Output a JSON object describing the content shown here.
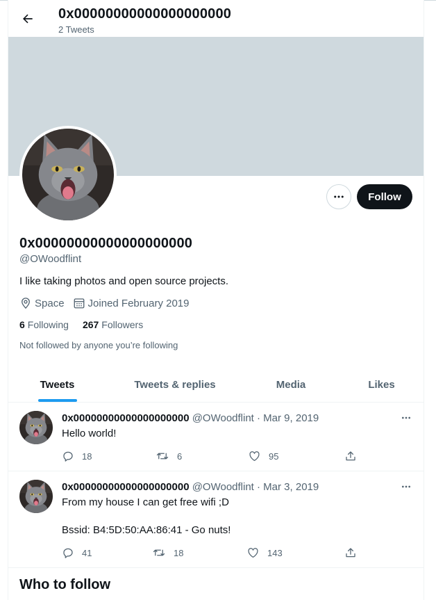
{
  "header": {
    "title": "0x00000000000000000000",
    "tweet_count": "2 Tweets"
  },
  "profile": {
    "display_name": "0x00000000000000000000",
    "handle": "@OWoodflint",
    "bio": "I like taking photos and open source projects.",
    "location": "Space",
    "joined": "Joined February 2019",
    "following_count": "6",
    "following_label": "Following",
    "followers_count": "267",
    "followers_label": "Followers",
    "not_followed": "Not followed by anyone you’re following",
    "follow_label": "Follow"
  },
  "tabs": [
    "Tweets",
    "Tweets & replies",
    "Media",
    "Likes"
  ],
  "tweets": [
    {
      "name": "0x00000000000000000000",
      "meta": "@OWoodflint · Mar 9, 2019",
      "lines": [
        "Hello world!"
      ],
      "replies": "18",
      "retweets": "6",
      "likes": "95"
    },
    {
      "name": "0x00000000000000000000",
      "meta": "@OWoodflint · Mar 3, 2019",
      "lines": [
        "From my house I can get free wifi ;D",
        "",
        "Bssid: B4:5D:50:AA:86:41 - Go nuts!"
      ],
      "replies": "41",
      "retweets": "18",
      "likes": "143"
    }
  ],
  "who_to_follow": "Who to follow",
  "colors": {
    "accent": "#1d9bf0",
    "banner": "#cfd9de",
    "follow_button": "#0f1419",
    "secondary_text": "#536471"
  },
  "icons": {
    "back": "arrow-left-icon",
    "more": "more-horizontal-icon",
    "location": "location-pin-icon",
    "calendar": "calendar-icon",
    "reply": "reply-icon",
    "retweet": "retweet-icon",
    "like": "heart-icon",
    "share": "share-icon"
  }
}
